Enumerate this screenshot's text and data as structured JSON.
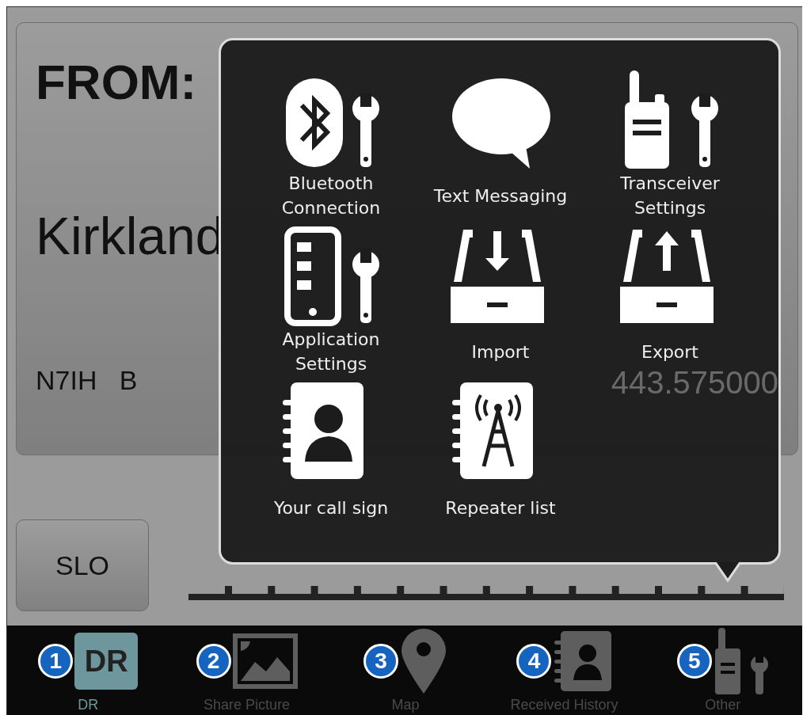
{
  "card": {
    "from_label": "FROM:",
    "location": "Kirkland",
    "callsign": "N7IH   B",
    "frequency": "443.575000"
  },
  "slo_button": {
    "label": "SLO"
  },
  "popover": {
    "items": [
      {
        "kind": "bluetooth",
        "label": "Bluetooth Connection"
      },
      {
        "kind": "message",
        "label": "Text Messaging"
      },
      {
        "kind": "transceiver",
        "label": "Transceiver Settings"
      },
      {
        "kind": "application",
        "label": "Application Settings"
      },
      {
        "kind": "import",
        "label": "Import"
      },
      {
        "kind": "export",
        "label": "Export"
      },
      {
        "kind": "callsign",
        "label": "Your call sign"
      },
      {
        "kind": "repeater",
        "label": "Repeater list"
      }
    ]
  },
  "tab_bar": {
    "tabs": [
      {
        "kind": "dr",
        "badge": "1",
        "icon_text": "DR",
        "label": "DR",
        "selected": true
      },
      {
        "kind": "picture",
        "badge": "2",
        "label": "Share Picture",
        "selected": false
      },
      {
        "kind": "map",
        "badge": "3",
        "label": "Map",
        "selected": false
      },
      {
        "kind": "history",
        "badge": "4",
        "label": "Received History",
        "selected": false
      },
      {
        "kind": "other",
        "badge": "5",
        "label": "Other",
        "selected": false
      }
    ]
  }
}
